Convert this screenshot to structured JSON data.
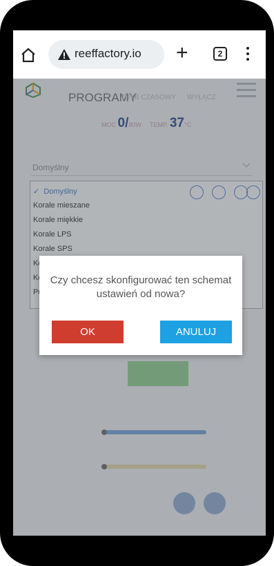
{
  "browser": {
    "url": "reeffactory.io",
    "tab_count": "2"
  },
  "header": {
    "title": "PROGRAMY",
    "nav": [
      "TRYB CZASOWY",
      "WYŁĄCZ"
    ],
    "power_label": "MOC",
    "power_value": "0/",
    "power_unit": "80W",
    "temp_label": "TEMP.",
    "temp_value": "37",
    "temp_unit": "°C"
  },
  "dropdown": {
    "selected": "Domyślny",
    "items": [
      "Domyślny",
      "Korale mieszane",
      "Korale miękkie",
      "Korale LPS",
      "Korale SPS",
      "Ko",
      "Ko",
      "Pu"
    ]
  },
  "modal": {
    "message": "Czy chcesz skonfigurować ten schemat ustawień od nowa?",
    "ok_label": "OK",
    "cancel_label": "ANULUJ"
  },
  "colors": {
    "ok": "#cf3d2e",
    "cancel": "#1da1e2",
    "accent": "#1b3f8c"
  }
}
